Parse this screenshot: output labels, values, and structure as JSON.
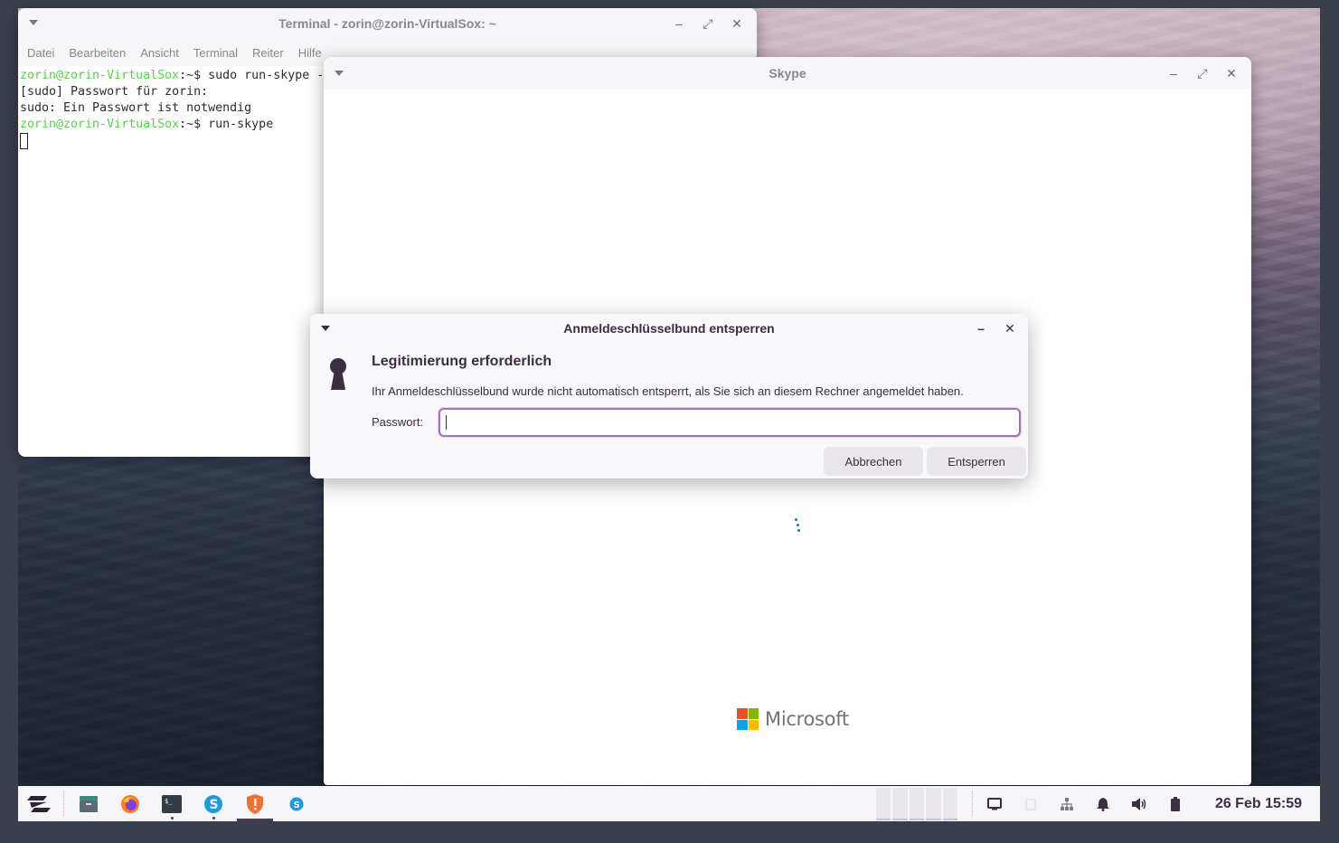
{
  "terminal": {
    "title": "Terminal - zorin@zorin-VirtualSox: ~",
    "menu": [
      "Datei",
      "Bearbeiten",
      "Ansicht",
      "Terminal",
      "Reiter",
      "Hilfe"
    ],
    "lines": [
      {
        "prompt": "zorin@zorin-VirtualSox",
        "rest": ":~$ sudo run-skype -"
      },
      {
        "prompt": "",
        "rest": "[sudo] Passwort für zorin:"
      },
      {
        "prompt": "",
        "rest": "sudo: Ein Passwort ist notwendig"
      },
      {
        "prompt": "zorin@zorin-VirtualSox",
        "rest": ":~$ run-skype"
      }
    ]
  },
  "skype": {
    "title": "Skype",
    "brand": "Microsoft"
  },
  "dialog": {
    "title": "Anmeldeschlüsselbund entsperren",
    "heading": "Legitimierung erforderlich",
    "message": "Ihr Anmeldeschlüsselbund wurde nicht automatisch entsperrt, als Sie sich an diesem Rechner angemeldet haben.",
    "password_label": "Passwort:",
    "password_value": "",
    "cancel_label": "Abbrechen",
    "unlock_label": "Entsperren"
  },
  "taskbar": {
    "apps": [
      "zorin-menu-icon",
      "files-icon",
      "firefox-icon",
      "terminal-icon",
      "skype-icon",
      "software-updater-icon",
      "skype-tray-icon"
    ],
    "clock": "26 Feb 15:59"
  },
  "colors": {
    "accent": "#a070c8",
    "terminal_prompt": "#55d04a",
    "dark_text": "#3a2e3f"
  }
}
